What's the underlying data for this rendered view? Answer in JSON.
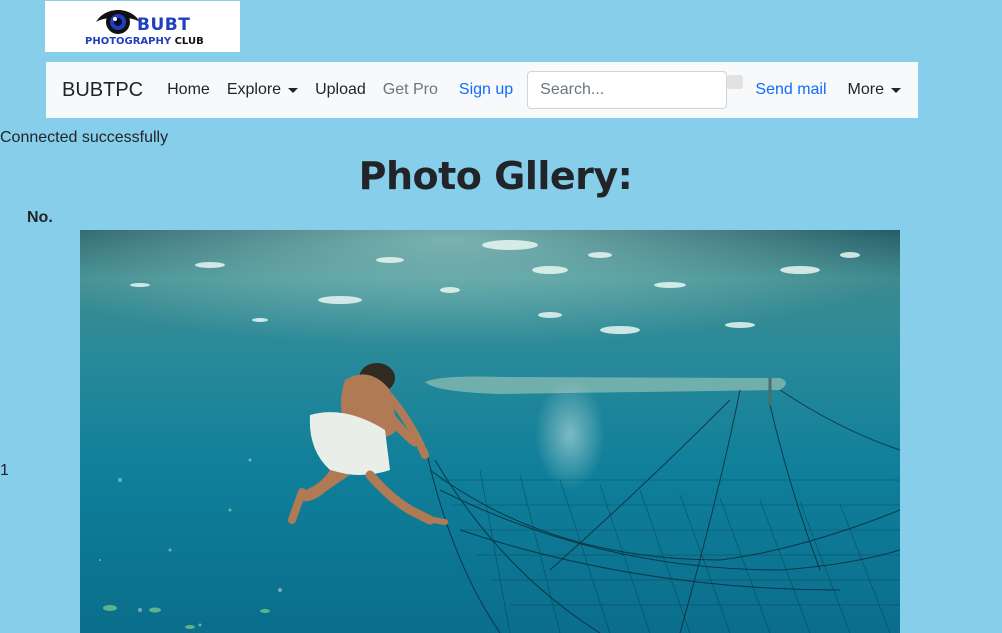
{
  "logo": {
    "title": "BUBT",
    "subtitle_part1": "PHOTOGRAPHY",
    "subtitle_part2": "CLUB"
  },
  "navbar": {
    "brand": "BUBTPC",
    "links": {
      "home": "Home",
      "explore": "Explore",
      "upload": "Upload",
      "get_pro": "Get Pro",
      "sign_up": "Sign up",
      "send_mail": "Send mail",
      "more": "More"
    },
    "search": {
      "placeholder": "Search...",
      "value": ""
    }
  },
  "status_text": "Connected successfully",
  "page_title": "Photo Gllery:",
  "table": {
    "header": "No.",
    "rows": [
      {
        "number": "1"
      }
    ]
  },
  "colors": {
    "page_background": "#87ceeb",
    "navbar_background": "#f8f9fa",
    "link_blue": "#0d6efd",
    "muted": "#6c757d"
  }
}
